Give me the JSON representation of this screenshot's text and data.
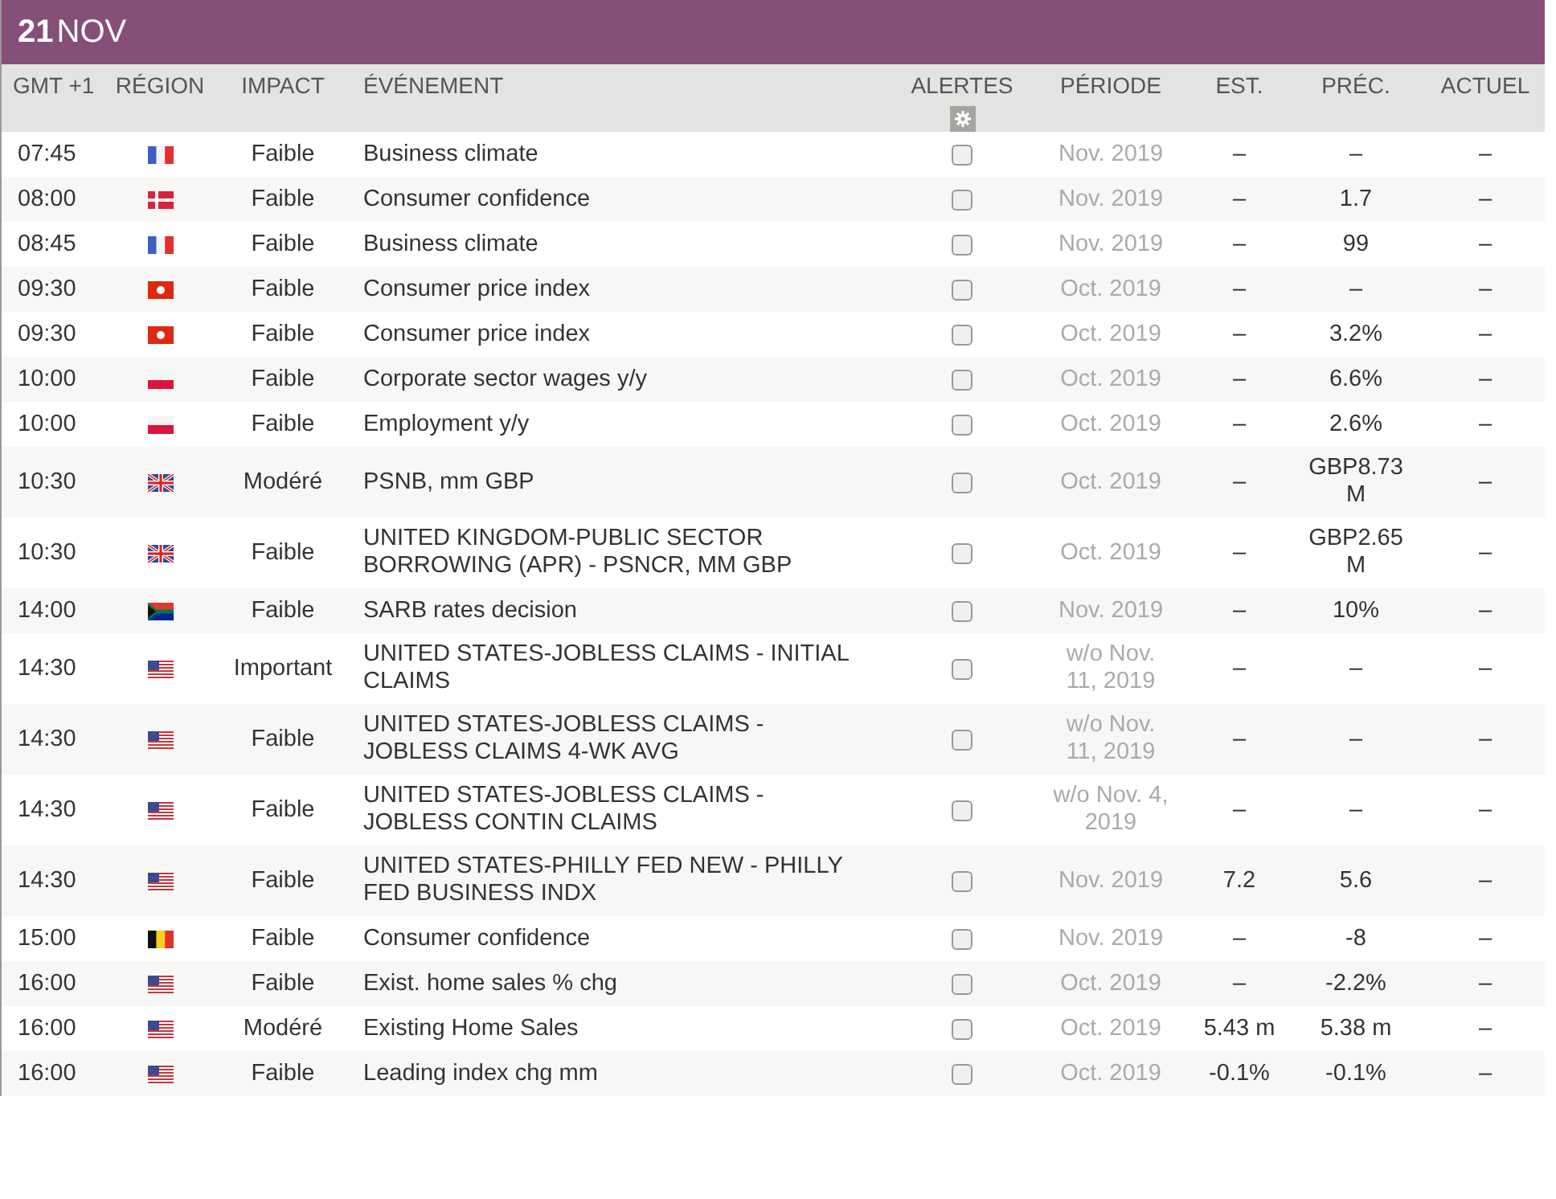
{
  "date": {
    "day": "21",
    "month": "NOV"
  },
  "columns": [
    "GMT +1",
    "RÉGION",
    "IMPACT",
    "ÉVÉNEMENT",
    "ALERTES",
    "PÉRIODE",
    "EST.",
    "PRÉC.",
    "ACTUEL"
  ],
  "rows": [
    {
      "time": "07:45",
      "flag": {
        "kind": "fr"
      },
      "impact": "Faible",
      "event": "Business climate",
      "alert": false,
      "period": "Nov. 2019",
      "est": "–",
      "prev": "–",
      "actual": "–"
    },
    {
      "time": "08:00",
      "flag": {
        "kind": "dk"
      },
      "impact": "Faible",
      "event": "Consumer confidence",
      "alert": false,
      "period": "Nov. 2019",
      "est": "–",
      "prev": "1.7",
      "actual": "–"
    },
    {
      "time": "08:45",
      "flag": {
        "kind": "fr"
      },
      "impact": "Faible",
      "event": "Business climate",
      "alert": false,
      "period": "Nov. 2019",
      "est": "–",
      "prev": "99",
      "actual": "–"
    },
    {
      "time": "09:30",
      "flag": {
        "kind": "hk"
      },
      "impact": "Faible",
      "event": "Consumer price index",
      "alert": false,
      "period": "Oct. 2019",
      "est": "–",
      "prev": "–",
      "actual": "–"
    },
    {
      "time": "09:30",
      "flag": {
        "kind": "hk"
      },
      "impact": "Faible",
      "event": "Consumer price index",
      "alert": false,
      "period": "Oct. 2019",
      "est": "–",
      "prev": "3.2%",
      "actual": "–"
    },
    {
      "time": "10:00",
      "flag": {
        "kind": "pl"
      },
      "impact": "Faible",
      "event": "Corporate sector wages y/y",
      "alert": false,
      "period": "Oct. 2019",
      "est": "–",
      "prev": "6.6%",
      "actual": "–"
    },
    {
      "time": "10:00",
      "flag": {
        "kind": "pl"
      },
      "impact": "Faible",
      "event": "Employment y/y",
      "alert": false,
      "period": "Oct. 2019",
      "est": "–",
      "prev": "2.6%",
      "actual": "–"
    },
    {
      "time": "10:30",
      "flag": {
        "kind": "gb"
      },
      "impact": "Modéré",
      "event": "PSNB, mm GBP",
      "alert": false,
      "period": "Oct. 2019",
      "est": "–",
      "prev": "GBP8.73 M",
      "actual": "–"
    },
    {
      "time": "10:30",
      "flag": {
        "kind": "gb"
      },
      "impact": "Faible",
      "event": "UNITED KINGDOM-PUBLIC SECTOR BORROWING (APR) - PSNCR, MM GBP",
      "alert": false,
      "period": "Oct. 2019",
      "est": "–",
      "prev": "GBP2.65 M",
      "actual": "–"
    },
    {
      "time": "14:00",
      "flag": {
        "kind": "za"
      },
      "impact": "Faible",
      "event": "SARB rates decision",
      "alert": false,
      "period": "Nov. 2019",
      "est": "–",
      "prev": "10%",
      "actual": "–"
    },
    {
      "time": "14:30",
      "flag": {
        "kind": "us"
      },
      "impact": "Important",
      "event": "UNITED STATES-JOBLESS CLAIMS - INITIAL CLAIMS",
      "alert": false,
      "period": "w/o Nov. 11, 2019",
      "est": "–",
      "prev": "–",
      "actual": "–"
    },
    {
      "time": "14:30",
      "flag": {
        "kind": "us"
      },
      "impact": "Faible",
      "event": "UNITED STATES-JOBLESS CLAIMS - JOBLESS CLAIMS 4-WK AVG",
      "alert": false,
      "period": "w/o Nov. 11, 2019",
      "est": "–",
      "prev": "–",
      "actual": "–"
    },
    {
      "time": "14:30",
      "flag": {
        "kind": "us"
      },
      "impact": "Faible",
      "event": "UNITED STATES-JOBLESS CLAIMS - JOBLESS CONTIN CLAIMS",
      "alert": false,
      "period": "w/o Nov. 4, 2019",
      "est": "–",
      "prev": "–",
      "actual": "–"
    },
    {
      "time": "14:30",
      "flag": {
        "kind": "us"
      },
      "impact": "Faible",
      "event": "UNITED STATES-PHILLY FED NEW - PHILLY FED BUSINESS INDX",
      "alert": false,
      "period": "Nov. 2019",
      "est": "7.2",
      "prev": "5.6",
      "actual": "–"
    },
    {
      "time": "15:00",
      "flag": {
        "kind": "be"
      },
      "impact": "Faible",
      "event": "Consumer confidence",
      "alert": false,
      "period": "Nov. 2019",
      "est": "–",
      "prev": "-8",
      "actual": "–"
    },
    {
      "time": "16:00",
      "flag": {
        "kind": "us"
      },
      "impact": "Faible",
      "event": "Exist. home sales % chg",
      "alert": false,
      "period": "Oct. 2019",
      "est": "–",
      "prev": "-2.2%",
      "actual": "–"
    },
    {
      "time": "16:00",
      "flag": {
        "kind": "us"
      },
      "impact": "Modéré",
      "event": "Existing Home Sales",
      "alert": false,
      "period": "Oct. 2019",
      "est": "5.43 m",
      "prev": "5.38 m",
      "actual": "–"
    },
    {
      "time": "16:00",
      "flag": {
        "kind": "us"
      },
      "impact": "Faible",
      "event": "Leading index chg mm",
      "alert": false,
      "period": "Oct. 2019",
      "est": "-0.1%",
      "prev": "-0.1%",
      "actual": "–"
    }
  ]
}
